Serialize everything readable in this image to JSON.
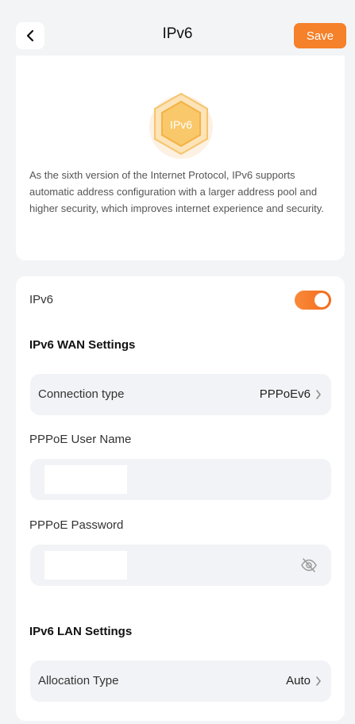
{
  "header": {
    "title": "IPv6",
    "save_label": "Save"
  },
  "intro": {
    "logo_text": "IPv6",
    "description": "As the sixth version of the Internet Protocol, IPv6 supports automatic address configuration with a larger address pool and higher security, which improves internet experience and security."
  },
  "settings": {
    "ipv6_toggle_label": "IPv6",
    "ipv6_enabled": true,
    "wan_section_title": "IPv6 WAN Settings",
    "connection_type_label": "Connection type",
    "connection_type_value": "PPPoEv6",
    "pppoe_user_label": "PPPoE User Name",
    "pppoe_user_value": "",
    "pppoe_password_label": "PPPoE Password",
    "pppoe_password_value": "",
    "lan_section_title": "IPv6 LAN Settings",
    "allocation_type_label": "Allocation Type",
    "allocation_type_value": "Auto"
  },
  "icons": {
    "back": "chevron-left-icon",
    "chevron": "chevron-right-icon",
    "eye": "eye-off-icon"
  },
  "colors": {
    "accent": "#f5812a",
    "toggle_on": "#f46a1a",
    "background": "#f3f4f6",
    "card": "#ffffff",
    "field": "#f2f3f6"
  }
}
